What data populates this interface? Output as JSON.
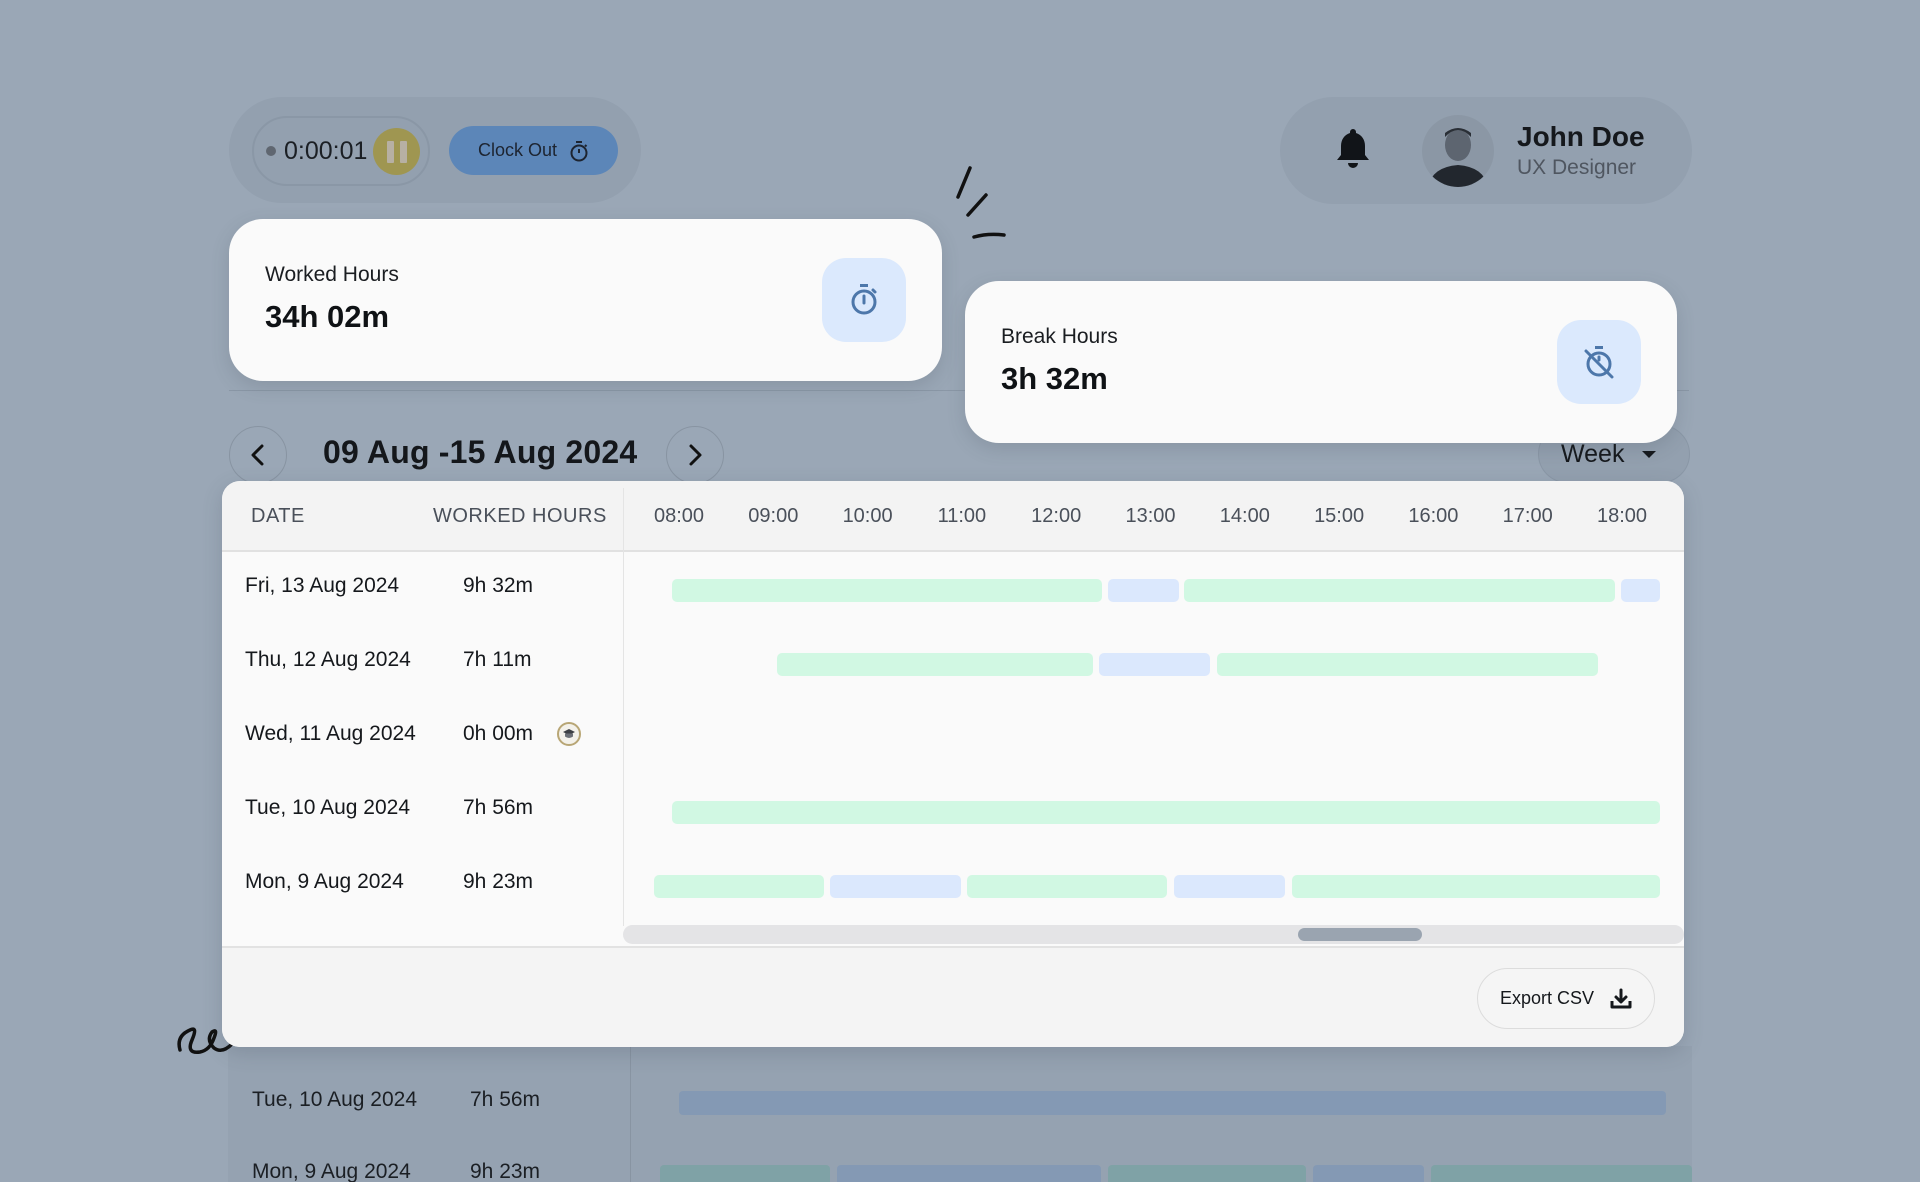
{
  "timer": {
    "elapsed": "0:00:01",
    "pause_icon": "pause-icon",
    "clock_out_label": "Clock Out",
    "clock_out_icon": "stopwatch-icon"
  },
  "profile": {
    "notification_icon": "bell-icon",
    "name": "John Doe",
    "role": "UX Designer"
  },
  "stats": {
    "worked": {
      "label": "Worked Hours",
      "value": "34h 02m",
      "icon": "stopwatch-icon"
    },
    "break": {
      "label": "Break Hours",
      "value": "3h 32m",
      "icon": "stopwatch-off-icon"
    }
  },
  "range": {
    "title": "09 Aug -15 Aug 2024",
    "prev_icon": "chevron-left-icon",
    "next_icon": "chevron-right-icon",
    "view_selected": "Week"
  },
  "table": {
    "columns": {
      "date": "DATE",
      "worked_hours": "WORKED HOURS"
    },
    "time_ticks": [
      "08:00",
      "09:00",
      "10:00",
      "11:00",
      "12:00",
      "13:00",
      "14:00",
      "15:00",
      "16:00",
      "17:00",
      "18:00"
    ],
    "time_axis_hours": [
      8,
      18
    ],
    "colors": {
      "work": "#d1f8e3",
      "break": "#dbe8fd"
    },
    "rows": [
      {
        "date": "Fri, 13 Aug 2024",
        "hours": "9h 32m",
        "leave": false,
        "segments": [
          {
            "type": "work",
            "start": 7.93,
            "end": 12.49
          },
          {
            "type": "break",
            "start": 12.55,
            "end": 13.3
          },
          {
            "type": "work",
            "start": 13.36,
            "end": 17.93
          },
          {
            "type": "break",
            "start": 17.99,
            "end": 18.4
          }
        ]
      },
      {
        "date": "Thu, 12 Aug 2024",
        "hours": "7h 11m",
        "leave": false,
        "segments": [
          {
            "type": "work",
            "start": 9.04,
            "end": 12.39
          },
          {
            "type": "break",
            "start": 12.45,
            "end": 13.63
          },
          {
            "type": "work",
            "start": 13.7,
            "end": 17.75
          }
        ]
      },
      {
        "date": "Wed, 11 Aug 2024",
        "hours": "0h 00m",
        "leave": true,
        "leave_icon": "graduation-cap-icon",
        "segments": []
      },
      {
        "date": "Tue, 10 Aug 2024",
        "hours": "7h 56m",
        "leave": false,
        "segments": [
          {
            "type": "work",
            "start": 7.93,
            "end": 18.4
          }
        ]
      },
      {
        "date": "Mon, 9 Aug 2024",
        "hours": "9h 23m",
        "leave": false,
        "segments": [
          {
            "type": "work",
            "start": 7.73,
            "end": 9.54
          },
          {
            "type": "break",
            "start": 9.6,
            "end": 10.99
          },
          {
            "type": "work",
            "start": 11.05,
            "end": 13.18
          },
          {
            "type": "break",
            "start": 13.25,
            "end": 14.43
          },
          {
            "type": "work",
            "start": 14.5,
            "end": 18.4
          }
        ]
      }
    ],
    "scroll_position": 0.72,
    "export_label": "Export CSV",
    "export_icon": "download-icon"
  },
  "background_rows": [
    {
      "date": "Tue, 10 Aug 2024",
      "hours": "7h 56m"
    },
    {
      "date": "Mon, 9 Aug 2024",
      "hours": "9h 23m"
    }
  ]
}
